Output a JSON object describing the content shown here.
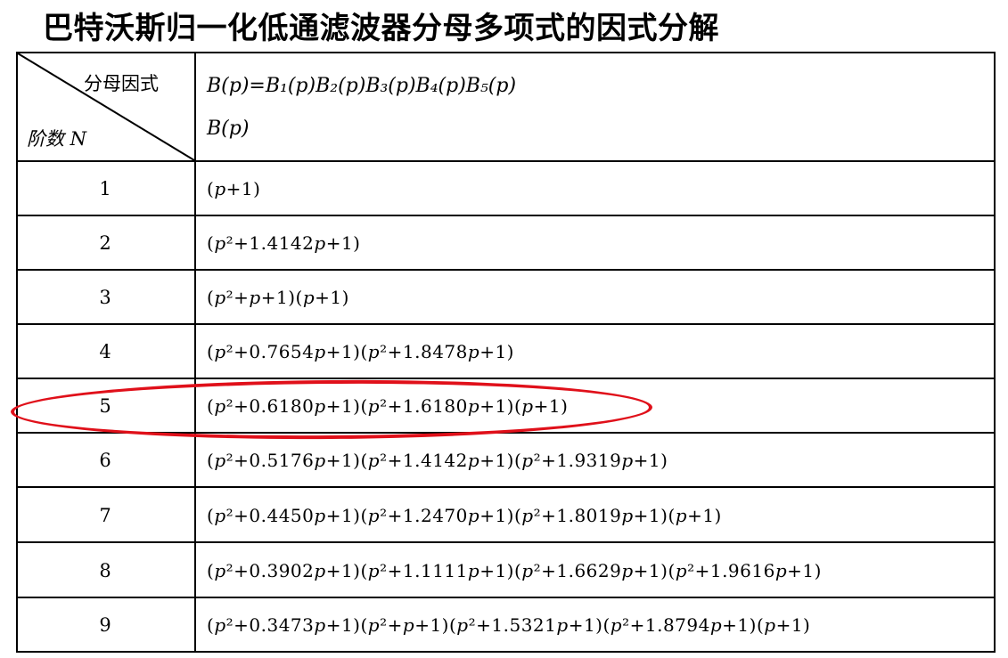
{
  "title": "巴特沃斯归一化低通滤波器分母多项式的因式分解",
  "header": {
    "col_factor_label": "分母因式",
    "col_order_label": "阶数 N",
    "formula_line1": "B(p)=B₁(p)B₂(p)B₃(p)B₄(p)B₅(p)",
    "formula_line2": "B(p)"
  },
  "rows": [
    {
      "n": "1",
      "factors": "(p+1)"
    },
    {
      "n": "2",
      "factors": "(p²+1.4142p+1)"
    },
    {
      "n": "3",
      "factors": "(p²+p+1)(p+1)"
    },
    {
      "n": "4",
      "factors": "(p²+0.7654p+1)(p²+1.8478p+1)"
    },
    {
      "n": "5",
      "factors": "(p²+0.6180p+1)(p²+1.6180p+1)(p+1)"
    },
    {
      "n": "6",
      "factors": "(p²+0.5176p+1)(p²+1.4142p+1)(p²+1.9319p+1)"
    },
    {
      "n": "7",
      "factors": "(p²+0.4450p+1)(p²+1.2470p+1)(p²+1.8019p+1)(p+1)"
    },
    {
      "n": "8",
      "factors": "(p²+0.3902p+1)(p²+1.1111p+1)(p²+1.6629p+1)(p²+1.9616p+1)"
    },
    {
      "n": "9",
      "factors": "(p²+0.3473p+1)(p²+p+1)(p²+1.5321p+1)(p²+1.8794p+1)(p+1)"
    }
  ],
  "highlight": {
    "row": "5",
    "color": "#e0101a"
  }
}
